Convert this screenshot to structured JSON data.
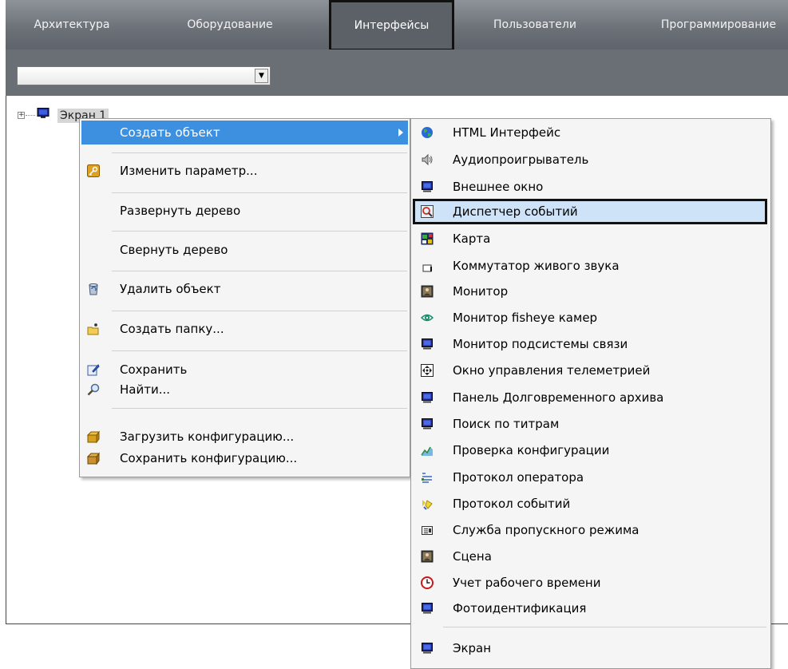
{
  "tabs": [
    {
      "label": "Архитектура",
      "active": false
    },
    {
      "label": "Оборудование",
      "active": false
    },
    {
      "label": "Интерфейсы",
      "active": true
    },
    {
      "label": "Пользователи",
      "active": false
    },
    {
      "label": "Программирование",
      "active": false
    }
  ],
  "combo": {
    "value": ""
  },
  "tree": {
    "node_label": "Экран 1",
    "expand_symbol": "+"
  },
  "context_menu": {
    "items": [
      {
        "label": "Создать объект",
        "icon": "none",
        "highlighted": true,
        "submenu": true
      },
      {
        "label": "Изменить параметр...",
        "icon": "edit-key-icon"
      },
      {
        "label": "Развернуть дерево",
        "icon": "none"
      },
      {
        "label": "Свернуть дерево",
        "icon": "none"
      },
      {
        "label": "Удалить объект",
        "icon": "recycle-bin-icon"
      },
      {
        "label": "Создать папку...",
        "icon": "new-folder-icon"
      },
      {
        "label": "Сохранить",
        "icon": "save-icon"
      },
      {
        "label": "Найти...",
        "icon": "search-icon"
      },
      {
        "label": "Загрузить конфигурацию...",
        "icon": "load-config-icon"
      },
      {
        "label": "Сохранить конфигурацию...",
        "icon": "save-config-icon"
      }
    ]
  },
  "submenu": {
    "items": [
      {
        "label": "HTML Интерфейс",
        "icon": "globe-icon"
      },
      {
        "label": "Аудиопроигрыватель",
        "icon": "speaker-icon"
      },
      {
        "label": "Внешнее окно",
        "icon": "monitor-icon"
      },
      {
        "label": "Диспетчер событий",
        "icon": "event-dispatcher-icon",
        "highlighted": true
      },
      {
        "label": "Карта",
        "icon": "map-icon"
      },
      {
        "label": "Коммутатор живого звука",
        "icon": "sound-switch-icon"
      },
      {
        "label": "Монитор",
        "icon": "video-monitor-icon"
      },
      {
        "label": "Монитор fisheye камер",
        "icon": "fisheye-eye-icon"
      },
      {
        "label": "Монитор подсистемы связи",
        "icon": "monitor-icon"
      },
      {
        "label": "Окно управления телеметрией",
        "icon": "telemetry-icon"
      },
      {
        "label": "Панель Долговременного архива",
        "icon": "monitor-icon"
      },
      {
        "label": "Поиск по титрам",
        "icon": "monitor-icon"
      },
      {
        "label": "Проверка конфигурации",
        "icon": "config-check-icon"
      },
      {
        "label": "Протокол оператора",
        "icon": "operator-log-icon"
      },
      {
        "label": "Протокол событий",
        "icon": "event-log-icon"
      },
      {
        "label": "Служба пропускного режима",
        "icon": "access-control-icon"
      },
      {
        "label": "Сцена",
        "icon": "scene-icon"
      },
      {
        "label": "Учет рабочего времени",
        "icon": "clock-icon"
      },
      {
        "label": "Фотоидентификация",
        "icon": "monitor-icon"
      },
      {
        "label": "Экран",
        "icon": "screen-icon"
      }
    ]
  },
  "colors": {
    "tabbar": "#6b7077",
    "menu_highlight": "#3d8fe0",
    "submenu_highlight": "#cfe3f8"
  }
}
